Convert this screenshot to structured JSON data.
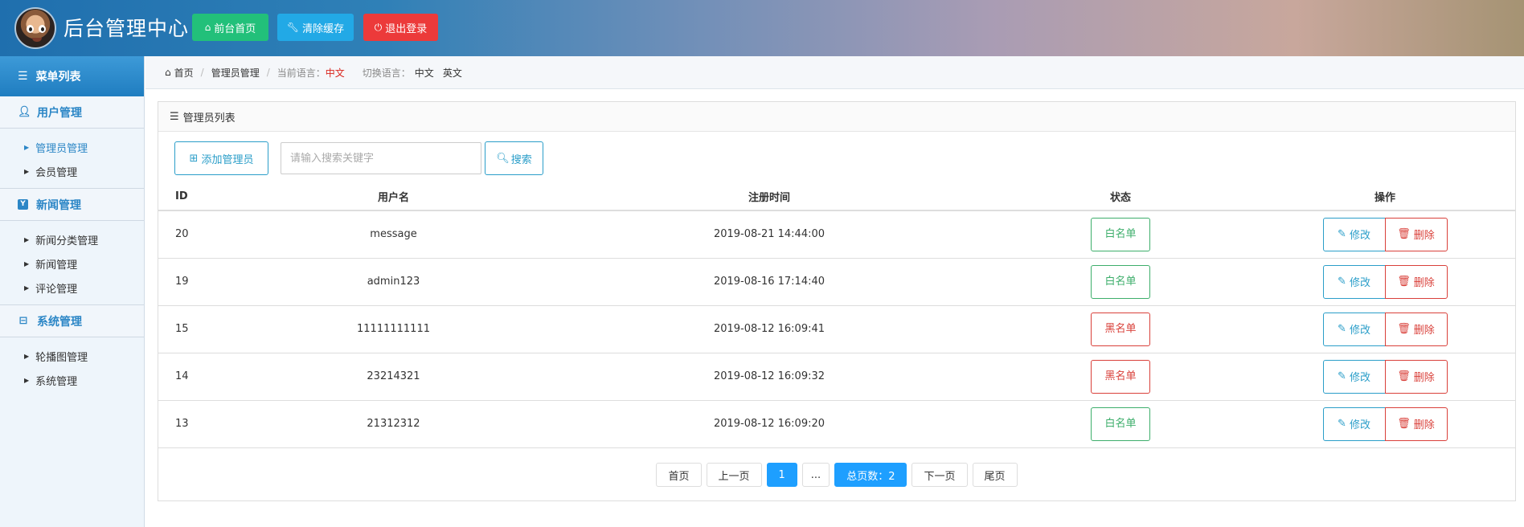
{
  "header": {
    "title": "后台管理中心",
    "buttons": [
      {
        "label": "前台首页",
        "icon": "home-icon",
        "color": "#22c07a"
      },
      {
        "label": "清除缓存",
        "icon": "wrench-icon",
        "color": "#22a9e6"
      },
      {
        "label": "退出登录",
        "icon": "power-icon",
        "color": "#ec3a3a"
      }
    ]
  },
  "sidebar": {
    "heading": "菜单列表",
    "groups": [
      {
        "label": "用户管理",
        "icon": "user-icon",
        "items": [
          "管理员管理",
          "会员管理"
        ],
        "active": "管理员管理"
      },
      {
        "label": "新闻管理",
        "icon": "news-icon",
        "items": [
          "新闻分类管理",
          "新闻管理",
          "评论管理"
        ]
      },
      {
        "label": "系统管理",
        "icon": "hdd-icon",
        "items": [
          "轮播图管理",
          "系统管理"
        ]
      }
    ]
  },
  "breadcrumb": {
    "home": "首页",
    "current": "管理员管理",
    "lang_label": "当前语言：",
    "lang_value": "中文",
    "switch_label": "切换语言：",
    "lang_options": [
      "中文",
      "英文"
    ]
  },
  "panel": {
    "title": "管理员列表",
    "add_label": "添加管理员",
    "search_placeholder": "请输入搜索关键字",
    "search_value": "",
    "search_label": "搜索",
    "columns": [
      "ID",
      "用户名",
      "注册时间",
      "状态",
      "操作"
    ],
    "rows": [
      {
        "id": "20",
        "username": "message",
        "time": "2019-08-21 14:44:00",
        "status": "白名单"
      },
      {
        "id": "19",
        "username": "admin123",
        "time": "2019-08-16 17:14:40",
        "status": "白名单"
      },
      {
        "id": "15",
        "username": "11111111111",
        "time": "2019-08-12 16:09:41",
        "status": "黑名单"
      },
      {
        "id": "14",
        "username": "23214321",
        "time": "2019-08-12 16:09:32",
        "status": "黑名单"
      },
      {
        "id": "13",
        "username": "21312312",
        "time": "2019-08-12 16:09:20",
        "status": "白名单"
      }
    ],
    "edit_label": "修改",
    "delete_label": "删除"
  },
  "pager": {
    "first": "首页",
    "prev": "上一页",
    "current": "1",
    "ellipsis": "...",
    "total_label": "总页数：2",
    "next": "下一页",
    "last": "尾页"
  },
  "colors": {
    "accent": "#2b9ec9",
    "white_list": "#3dae6b",
    "black_list": "#d9403a",
    "page_active": "#1e9fff"
  }
}
